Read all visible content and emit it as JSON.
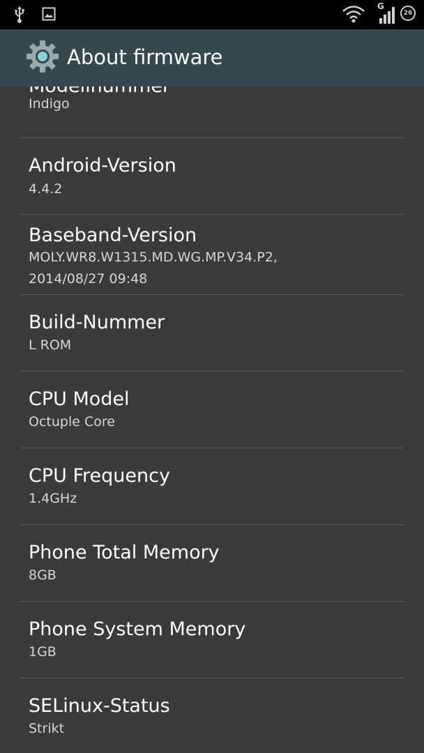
{
  "status_bar": {
    "network_type": "G",
    "battery_level": "26"
  },
  "action_bar": {
    "title": "About firmware"
  },
  "items": [
    {
      "title": "Modellnummer",
      "value": "Indigo"
    },
    {
      "title": "Android-Version",
      "value": "4.4.2"
    },
    {
      "title": "Baseband-Version",
      "value": "MOLY.WR8.W1315.MD.WG.MP.V34.P2,\n2014/08/27 09:48"
    },
    {
      "title": "Build-Nummer",
      "value": "L ROM"
    },
    {
      "title": "CPU Model",
      "value": "Octuple Core"
    },
    {
      "title": "CPU Frequency",
      "value": "1.4GHz"
    },
    {
      "title": "Phone Total Memory",
      "value": "8GB"
    },
    {
      "title": "Phone System Memory",
      "value": "1GB"
    },
    {
      "title": "SELinux-Status",
      "value": "Strikt"
    }
  ]
}
